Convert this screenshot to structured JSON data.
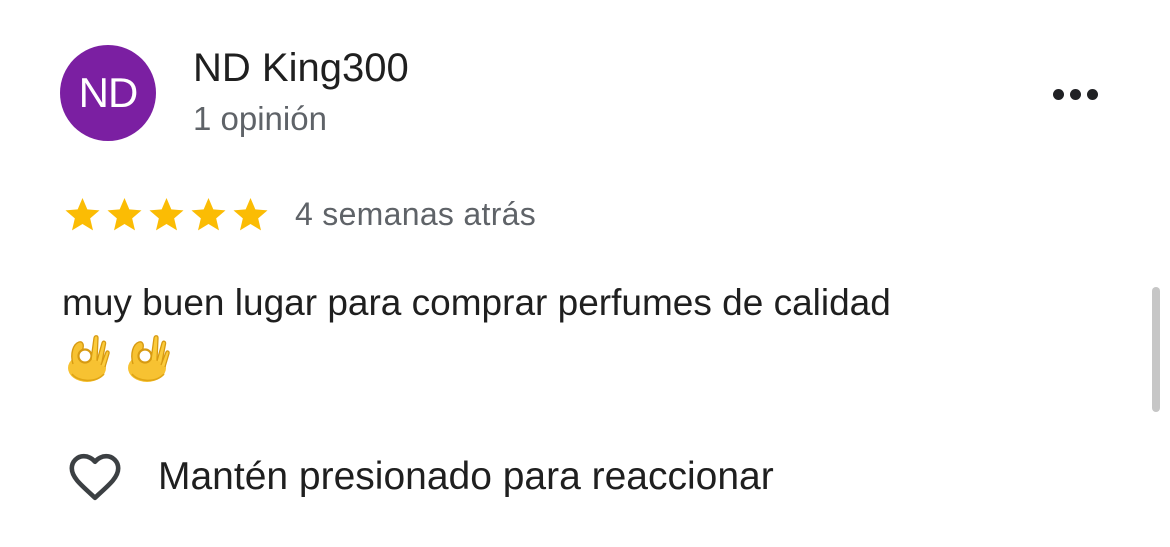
{
  "reviewer": {
    "initials": "ND",
    "name": "ND King300",
    "review_count": "1 opinión",
    "avatar_color": "#7B1FA2"
  },
  "more_menu": {
    "icon": "more-horizontal-icon"
  },
  "review": {
    "rating": 5,
    "rating_max": 5,
    "star_color": "#FBBC04",
    "timestamp": "4 semanas atrás",
    "text": "muy buen lugar para comprar perfumes de calidad",
    "emojis": [
      "ok-hand-emoji",
      "ok-hand-emoji"
    ]
  },
  "reaction": {
    "icon": "heart-outline-icon",
    "label": "Mantén presionado para reaccionar"
  }
}
